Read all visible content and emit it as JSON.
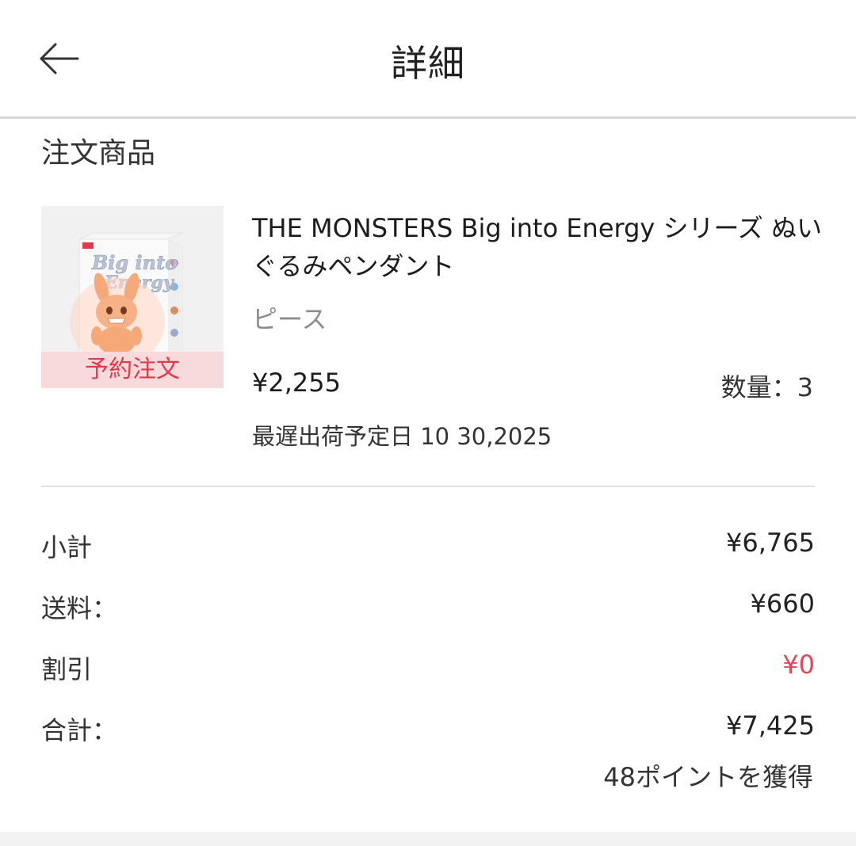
{
  "header": {
    "title": "詳細",
    "back_icon": "arrow-left-icon"
  },
  "order_items": {
    "section_title": "注文商品",
    "product": {
      "name": "THE MONSTERS Big into Energy シリーズ ぬいぐるみペンダント",
      "variant": "ピース",
      "price": "¥2,255",
      "quantity": "数量：3",
      "ship_date": "最遅出荷予定日 10 30,2025",
      "badge": "予約注文",
      "image_text": "Big into Energy"
    }
  },
  "summary": {
    "subtotal": {
      "label": "小計",
      "value": "¥6,765"
    },
    "shipping": {
      "label": "送料：",
      "value": "¥660"
    },
    "discount": {
      "label": "割引",
      "value": "¥0"
    },
    "total": {
      "label": "合計：",
      "value": "¥7,425"
    },
    "points": "48ポイントを獲得"
  },
  "colors": {
    "accent_red": "#e0394a",
    "badge_bg": "#f8dadd",
    "divider": "#d6d6d6"
  }
}
